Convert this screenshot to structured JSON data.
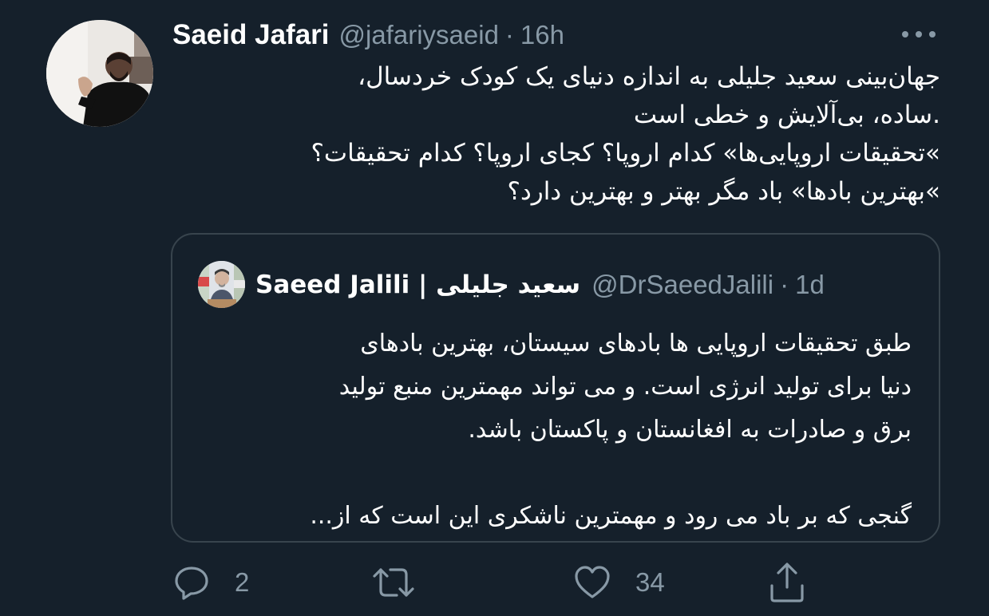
{
  "tweet": {
    "author": {
      "display_name": "Saeid Jafari",
      "handle": "@jafariysaeid",
      "separator": "·",
      "time": "16h"
    },
    "text_lines": [
      "جهان‌بینی سعید جلیلی به اندازه دنیای یک کودک خردسال،",
      ".ساده، بی‌آلایش و خطی است",
      "»تحقیقات اروپایی‌ها» کدام اروپا؟ کجای اروپا؟ کدام تحقیقات؟",
      "»بهترین بادها» باد مگر بهتر و بهترین دارد؟"
    ],
    "more_icon": "more-horizontal-icon"
  },
  "quote": {
    "author": {
      "display_name": "Saeed Jalili | سعید جلیلی",
      "handle": "@DrSaeedJalili",
      "separator": "·",
      "time": "1d"
    },
    "text_lines": [
      "طبق تحقیقات اروپایی ها بادهای سیستان، بهترین بادهای",
      "دنیا برای تولید انرژی است. و می تواند مهمترین منبع تولید",
      "برق و صادرات به افغانستان و پاکستان باشد.",
      "",
      "گنجی که بر باد می رود و مهمترین ناشکری این است که از..."
    ]
  },
  "actions": {
    "reply": {
      "icon": "reply-icon",
      "count": "2"
    },
    "retweet": {
      "icon": "retweet-icon",
      "count": ""
    },
    "like": {
      "icon": "heart-icon",
      "count": "34"
    },
    "share": {
      "icon": "share-icon"
    }
  },
  "colors": {
    "background": "#15202b",
    "text": "#ffffff",
    "secondary": "#8899a6",
    "border": "#38444d"
  }
}
